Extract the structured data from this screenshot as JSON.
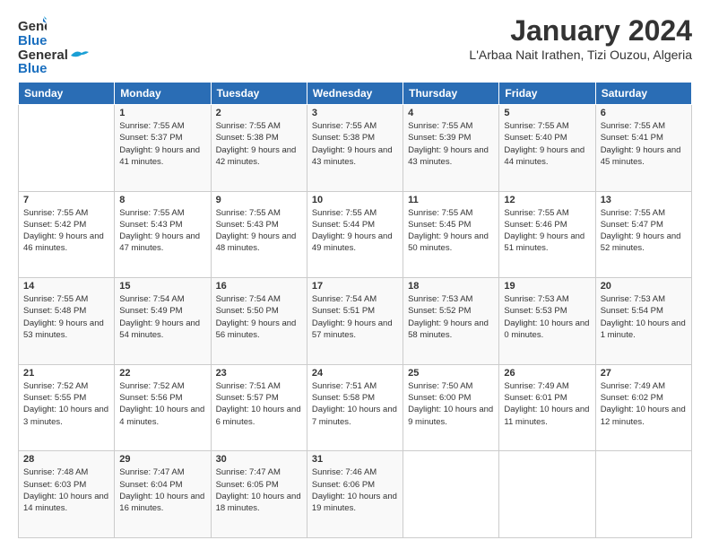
{
  "header": {
    "logo_line1": "General",
    "logo_line2": "Blue",
    "month": "January 2024",
    "location": "L'Arbaa Nait Irathen, Tizi Ouzou, Algeria"
  },
  "days": [
    "Sunday",
    "Monday",
    "Tuesday",
    "Wednesday",
    "Thursday",
    "Friday",
    "Saturday"
  ],
  "weeks": [
    [
      {
        "day": "",
        "sunrise": "",
        "sunset": "",
        "daylight": ""
      },
      {
        "day": "1",
        "sunrise": "Sunrise: 7:55 AM",
        "sunset": "Sunset: 5:37 PM",
        "daylight": "Daylight: 9 hours and 41 minutes."
      },
      {
        "day": "2",
        "sunrise": "Sunrise: 7:55 AM",
        "sunset": "Sunset: 5:38 PM",
        "daylight": "Daylight: 9 hours and 42 minutes."
      },
      {
        "day": "3",
        "sunrise": "Sunrise: 7:55 AM",
        "sunset": "Sunset: 5:38 PM",
        "daylight": "Daylight: 9 hours and 43 minutes."
      },
      {
        "day": "4",
        "sunrise": "Sunrise: 7:55 AM",
        "sunset": "Sunset: 5:39 PM",
        "daylight": "Daylight: 9 hours and 43 minutes."
      },
      {
        "day": "5",
        "sunrise": "Sunrise: 7:55 AM",
        "sunset": "Sunset: 5:40 PM",
        "daylight": "Daylight: 9 hours and 44 minutes."
      },
      {
        "day": "6",
        "sunrise": "Sunrise: 7:55 AM",
        "sunset": "Sunset: 5:41 PM",
        "daylight": "Daylight: 9 hours and 45 minutes."
      }
    ],
    [
      {
        "day": "7",
        "sunrise": "Sunrise: 7:55 AM",
        "sunset": "Sunset: 5:42 PM",
        "daylight": "Daylight: 9 hours and 46 minutes."
      },
      {
        "day": "8",
        "sunrise": "Sunrise: 7:55 AM",
        "sunset": "Sunset: 5:43 PM",
        "daylight": "Daylight: 9 hours and 47 minutes."
      },
      {
        "day": "9",
        "sunrise": "Sunrise: 7:55 AM",
        "sunset": "Sunset: 5:43 PM",
        "daylight": "Daylight: 9 hours and 48 minutes."
      },
      {
        "day": "10",
        "sunrise": "Sunrise: 7:55 AM",
        "sunset": "Sunset: 5:44 PM",
        "daylight": "Daylight: 9 hours and 49 minutes."
      },
      {
        "day": "11",
        "sunrise": "Sunrise: 7:55 AM",
        "sunset": "Sunset: 5:45 PM",
        "daylight": "Daylight: 9 hours and 50 minutes."
      },
      {
        "day": "12",
        "sunrise": "Sunrise: 7:55 AM",
        "sunset": "Sunset: 5:46 PM",
        "daylight": "Daylight: 9 hours and 51 minutes."
      },
      {
        "day": "13",
        "sunrise": "Sunrise: 7:55 AM",
        "sunset": "Sunset: 5:47 PM",
        "daylight": "Daylight: 9 hours and 52 minutes."
      }
    ],
    [
      {
        "day": "14",
        "sunrise": "Sunrise: 7:55 AM",
        "sunset": "Sunset: 5:48 PM",
        "daylight": "Daylight: 9 hours and 53 minutes."
      },
      {
        "day": "15",
        "sunrise": "Sunrise: 7:54 AM",
        "sunset": "Sunset: 5:49 PM",
        "daylight": "Daylight: 9 hours and 54 minutes."
      },
      {
        "day": "16",
        "sunrise": "Sunrise: 7:54 AM",
        "sunset": "Sunset: 5:50 PM",
        "daylight": "Daylight: 9 hours and 56 minutes."
      },
      {
        "day": "17",
        "sunrise": "Sunrise: 7:54 AM",
        "sunset": "Sunset: 5:51 PM",
        "daylight": "Daylight: 9 hours and 57 minutes."
      },
      {
        "day": "18",
        "sunrise": "Sunrise: 7:53 AM",
        "sunset": "Sunset: 5:52 PM",
        "daylight": "Daylight: 9 hours and 58 minutes."
      },
      {
        "day": "19",
        "sunrise": "Sunrise: 7:53 AM",
        "sunset": "Sunset: 5:53 PM",
        "daylight": "Daylight: 10 hours and 0 minutes."
      },
      {
        "day": "20",
        "sunrise": "Sunrise: 7:53 AM",
        "sunset": "Sunset: 5:54 PM",
        "daylight": "Daylight: 10 hours and 1 minute."
      }
    ],
    [
      {
        "day": "21",
        "sunrise": "Sunrise: 7:52 AM",
        "sunset": "Sunset: 5:55 PM",
        "daylight": "Daylight: 10 hours and 3 minutes."
      },
      {
        "day": "22",
        "sunrise": "Sunrise: 7:52 AM",
        "sunset": "Sunset: 5:56 PM",
        "daylight": "Daylight: 10 hours and 4 minutes."
      },
      {
        "day": "23",
        "sunrise": "Sunrise: 7:51 AM",
        "sunset": "Sunset: 5:57 PM",
        "daylight": "Daylight: 10 hours and 6 minutes."
      },
      {
        "day": "24",
        "sunrise": "Sunrise: 7:51 AM",
        "sunset": "Sunset: 5:58 PM",
        "daylight": "Daylight: 10 hours and 7 minutes."
      },
      {
        "day": "25",
        "sunrise": "Sunrise: 7:50 AM",
        "sunset": "Sunset: 6:00 PM",
        "daylight": "Daylight: 10 hours and 9 minutes."
      },
      {
        "day": "26",
        "sunrise": "Sunrise: 7:49 AM",
        "sunset": "Sunset: 6:01 PM",
        "daylight": "Daylight: 10 hours and 11 minutes."
      },
      {
        "day": "27",
        "sunrise": "Sunrise: 7:49 AM",
        "sunset": "Sunset: 6:02 PM",
        "daylight": "Daylight: 10 hours and 12 minutes."
      }
    ],
    [
      {
        "day": "28",
        "sunrise": "Sunrise: 7:48 AM",
        "sunset": "Sunset: 6:03 PM",
        "daylight": "Daylight: 10 hours and 14 minutes."
      },
      {
        "day": "29",
        "sunrise": "Sunrise: 7:47 AM",
        "sunset": "Sunset: 6:04 PM",
        "daylight": "Daylight: 10 hours and 16 minutes."
      },
      {
        "day": "30",
        "sunrise": "Sunrise: 7:47 AM",
        "sunset": "Sunset: 6:05 PM",
        "daylight": "Daylight: 10 hours and 18 minutes."
      },
      {
        "day": "31",
        "sunrise": "Sunrise: 7:46 AM",
        "sunset": "Sunset: 6:06 PM",
        "daylight": "Daylight: 10 hours and 19 minutes."
      },
      {
        "day": "",
        "sunrise": "",
        "sunset": "",
        "daylight": ""
      },
      {
        "day": "",
        "sunrise": "",
        "sunset": "",
        "daylight": ""
      },
      {
        "day": "",
        "sunrise": "",
        "sunset": "",
        "daylight": ""
      }
    ]
  ]
}
